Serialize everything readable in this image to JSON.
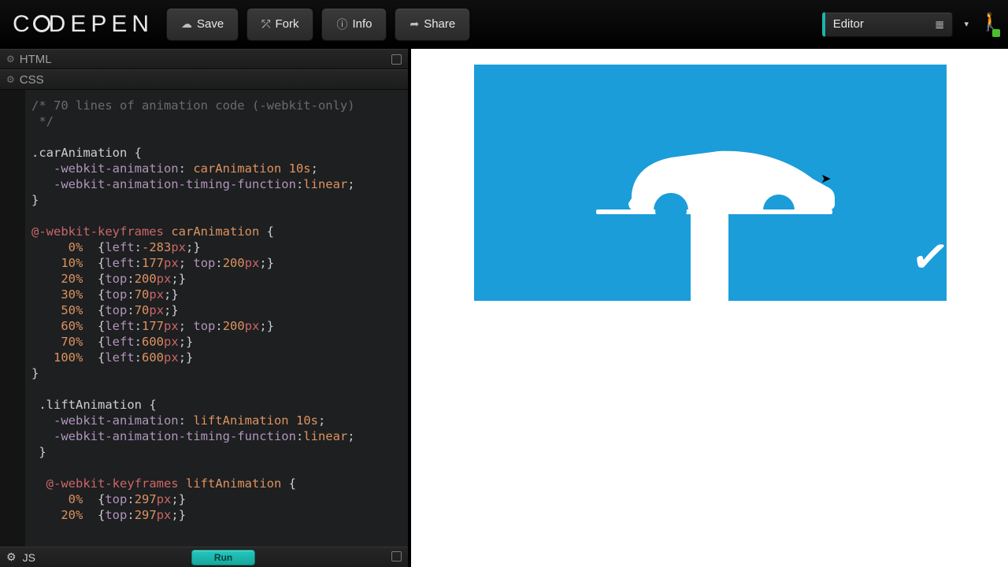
{
  "app": {
    "logo_text": "CODEPEN"
  },
  "toolbar": {
    "save": "Save",
    "fork": "Fork",
    "info": "Info",
    "share": "Share"
  },
  "view": {
    "editor_label": "Editor"
  },
  "panels": {
    "html": "HTML",
    "css": "CSS",
    "js": "JS",
    "run": "Run"
  },
  "css_code": {
    "comment": "/* 70 lines of animation code (-webkit-only) */",
    "car_sel": ".carAnimation",
    "anim_prop": "-webkit-animation",
    "anim_val_name": "carAnimation",
    "anim_val_dur": "10s",
    "timing_prop": "-webkit-animation-timing-function",
    "timing_val": "linear",
    "kf_rule": "@-webkit-keyframes",
    "car_kf_name": "carAnimation",
    "car_frames": [
      {
        "p": "0%",
        "decls": [
          [
            "left",
            "-283px"
          ]
        ]
      },
      {
        "p": "10%",
        "decls": [
          [
            "left",
            "177px"
          ],
          [
            "top",
            "200px"
          ]
        ]
      },
      {
        "p": "20%",
        "decls": [
          [
            "top",
            "200px"
          ]
        ]
      },
      {
        "p": "30%",
        "decls": [
          [
            "top",
            "70px"
          ]
        ]
      },
      {
        "p": "50%",
        "decls": [
          [
            "top",
            "70px"
          ]
        ]
      },
      {
        "p": "60%",
        "decls": [
          [
            "left",
            "177px"
          ],
          [
            "top",
            "200px"
          ]
        ]
      },
      {
        "p": "70%",
        "decls": [
          [
            "left",
            "600px"
          ]
        ]
      },
      {
        "p": "100%",
        "decls": [
          [
            "left",
            "600px"
          ]
        ]
      }
    ],
    "lift_sel": ".liftAnimation",
    "lift_kf_name": "liftAnimation",
    "lift_frames": [
      {
        "p": "0%",
        "decls": [
          [
            "top",
            "297px"
          ]
        ]
      },
      {
        "p": "20%",
        "decls": [
          [
            "top",
            "297px"
          ]
        ]
      }
    ]
  }
}
